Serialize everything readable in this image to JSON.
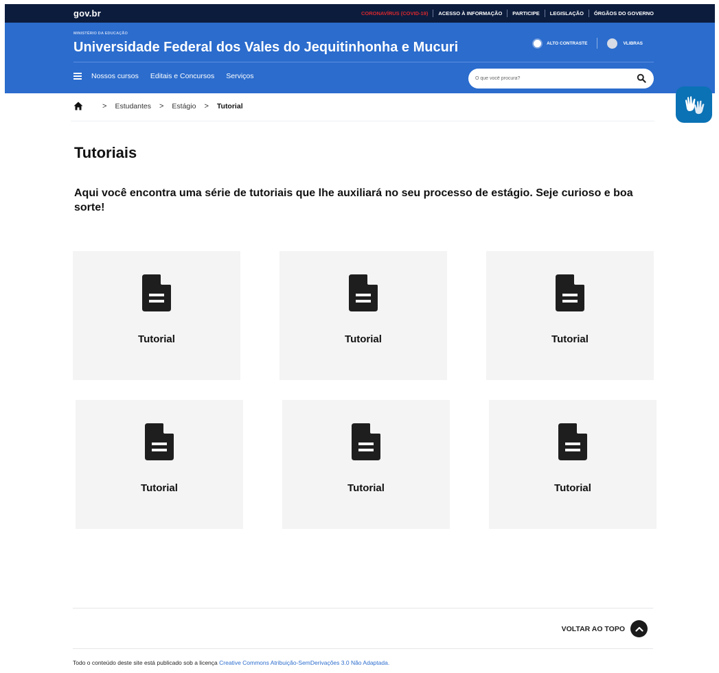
{
  "govbar": {
    "brand": "gov.br",
    "links": [
      "CORONAVÍRUS (COVID-19)",
      "ACESSO À INFORMAÇÃO",
      "PARTICIPE",
      "LEGISLAÇÃO",
      "ÓRGÃOS DO GOVERNO"
    ]
  },
  "header": {
    "ministry": "MINISTÉRIO DA EDUCAÇÃO",
    "site_name": "Universidade Federal dos Vales do Jequitinhonha e Mucuri",
    "contrast_label": "ALTO CONTRASTE",
    "vlibras_label": "VLIBRAS",
    "nav": [
      "Nossos cursos",
      "Editais e Concursos",
      "Serviços"
    ],
    "search_placeholder": "O que você procura?"
  },
  "breadcrumb": {
    "items": [
      "Estudantes",
      "Estágio"
    ],
    "current": "Tutorial"
  },
  "page": {
    "title": "Tutoriais",
    "intro": "Aqui você encontra uma série de tutoriais que lhe auxiliará no seu processo de estágio. Seje curioso e boa sorte!"
  },
  "cards": [
    {
      "label": "Tutorial",
      "icon": "file-document-icon"
    },
    {
      "label": "Tutorial",
      "icon": "file-document-icon"
    },
    {
      "label": "Tutorial",
      "icon": "file-document-icon"
    },
    {
      "label": "Tutorial",
      "icon": "file-document-icon"
    },
    {
      "label": "Tutorial",
      "icon": "file-document-icon"
    },
    {
      "label": "Tutorial",
      "icon": "file-document-icon"
    }
  ],
  "footer": {
    "back_to_top": "VOLTAR AO TOPO",
    "license_text": "Todo o conteúdo deste site está publicado sob a licença",
    "license_link": "Creative Commons Atribuição-SemDerivações 3.0 Não Adaptada."
  },
  "colors": {
    "govbar": "#0c1c3d",
    "header": "#2b6ccd",
    "alert": "#d8282f",
    "card": "#f4f4f4",
    "vlibras": "#0b72b5"
  }
}
